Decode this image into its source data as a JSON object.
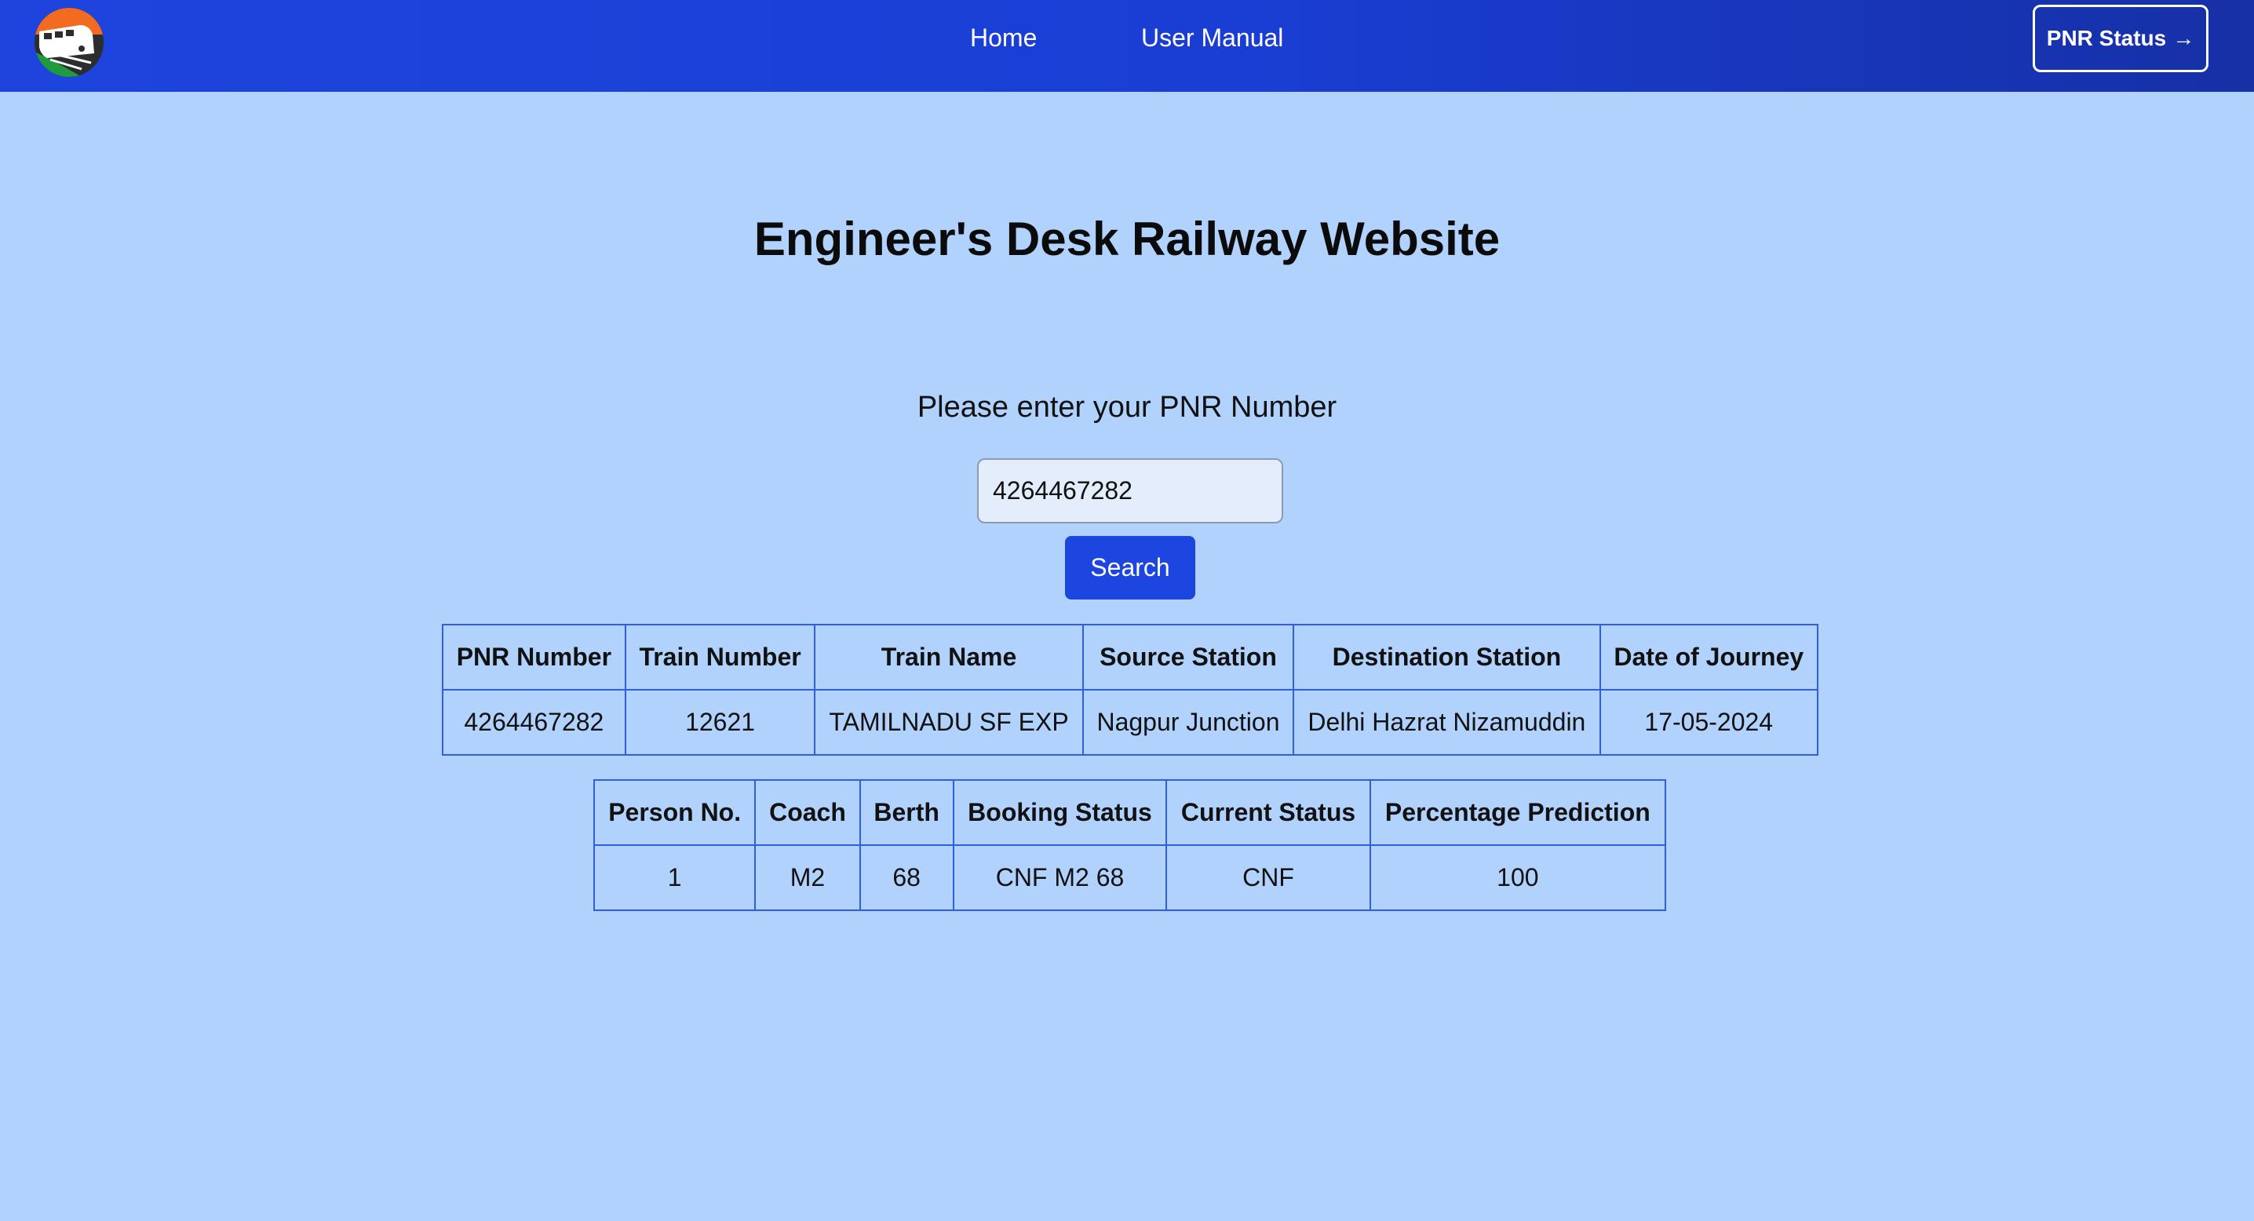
{
  "nav": {
    "links": [
      "Home",
      "User Manual"
    ],
    "pnr_status_label": "PNR Status",
    "pnr_status_arrow": "→"
  },
  "main": {
    "title": "Engineer's Desk Railway Website",
    "prompt": "Please enter your PNR Number",
    "pnr_value": "4264467282",
    "search_label": "Search"
  },
  "train_table": {
    "headers": [
      "PNR Number",
      "Train Number",
      "Train Name",
      "Source Station",
      "Destination Station",
      "Date of Journey"
    ],
    "rows": [
      [
        "4264467282",
        "12621",
        "TAMILNADU SF EXP",
        "Nagpur Junction",
        "Delhi Hazrat Nizamuddin",
        "17-05-2024"
      ]
    ]
  },
  "passenger_table": {
    "headers": [
      "Person No.",
      "Coach",
      "Berth",
      "Booking Status",
      "Current Status",
      "Percentage Prediction"
    ],
    "rows": [
      [
        "1",
        "M2",
        "68",
        "CNF M2 68",
        "CNF",
        "100"
      ]
    ]
  },
  "colors": {
    "page_background": "#b1d2fc",
    "navbar": "#1d45dd",
    "accent_button": "#1d45e0",
    "table_border": "#2f5ee0"
  },
  "icons": {
    "logo": "railway-train-logo-icon",
    "pnr_arrow": "arrow-right-icon"
  }
}
